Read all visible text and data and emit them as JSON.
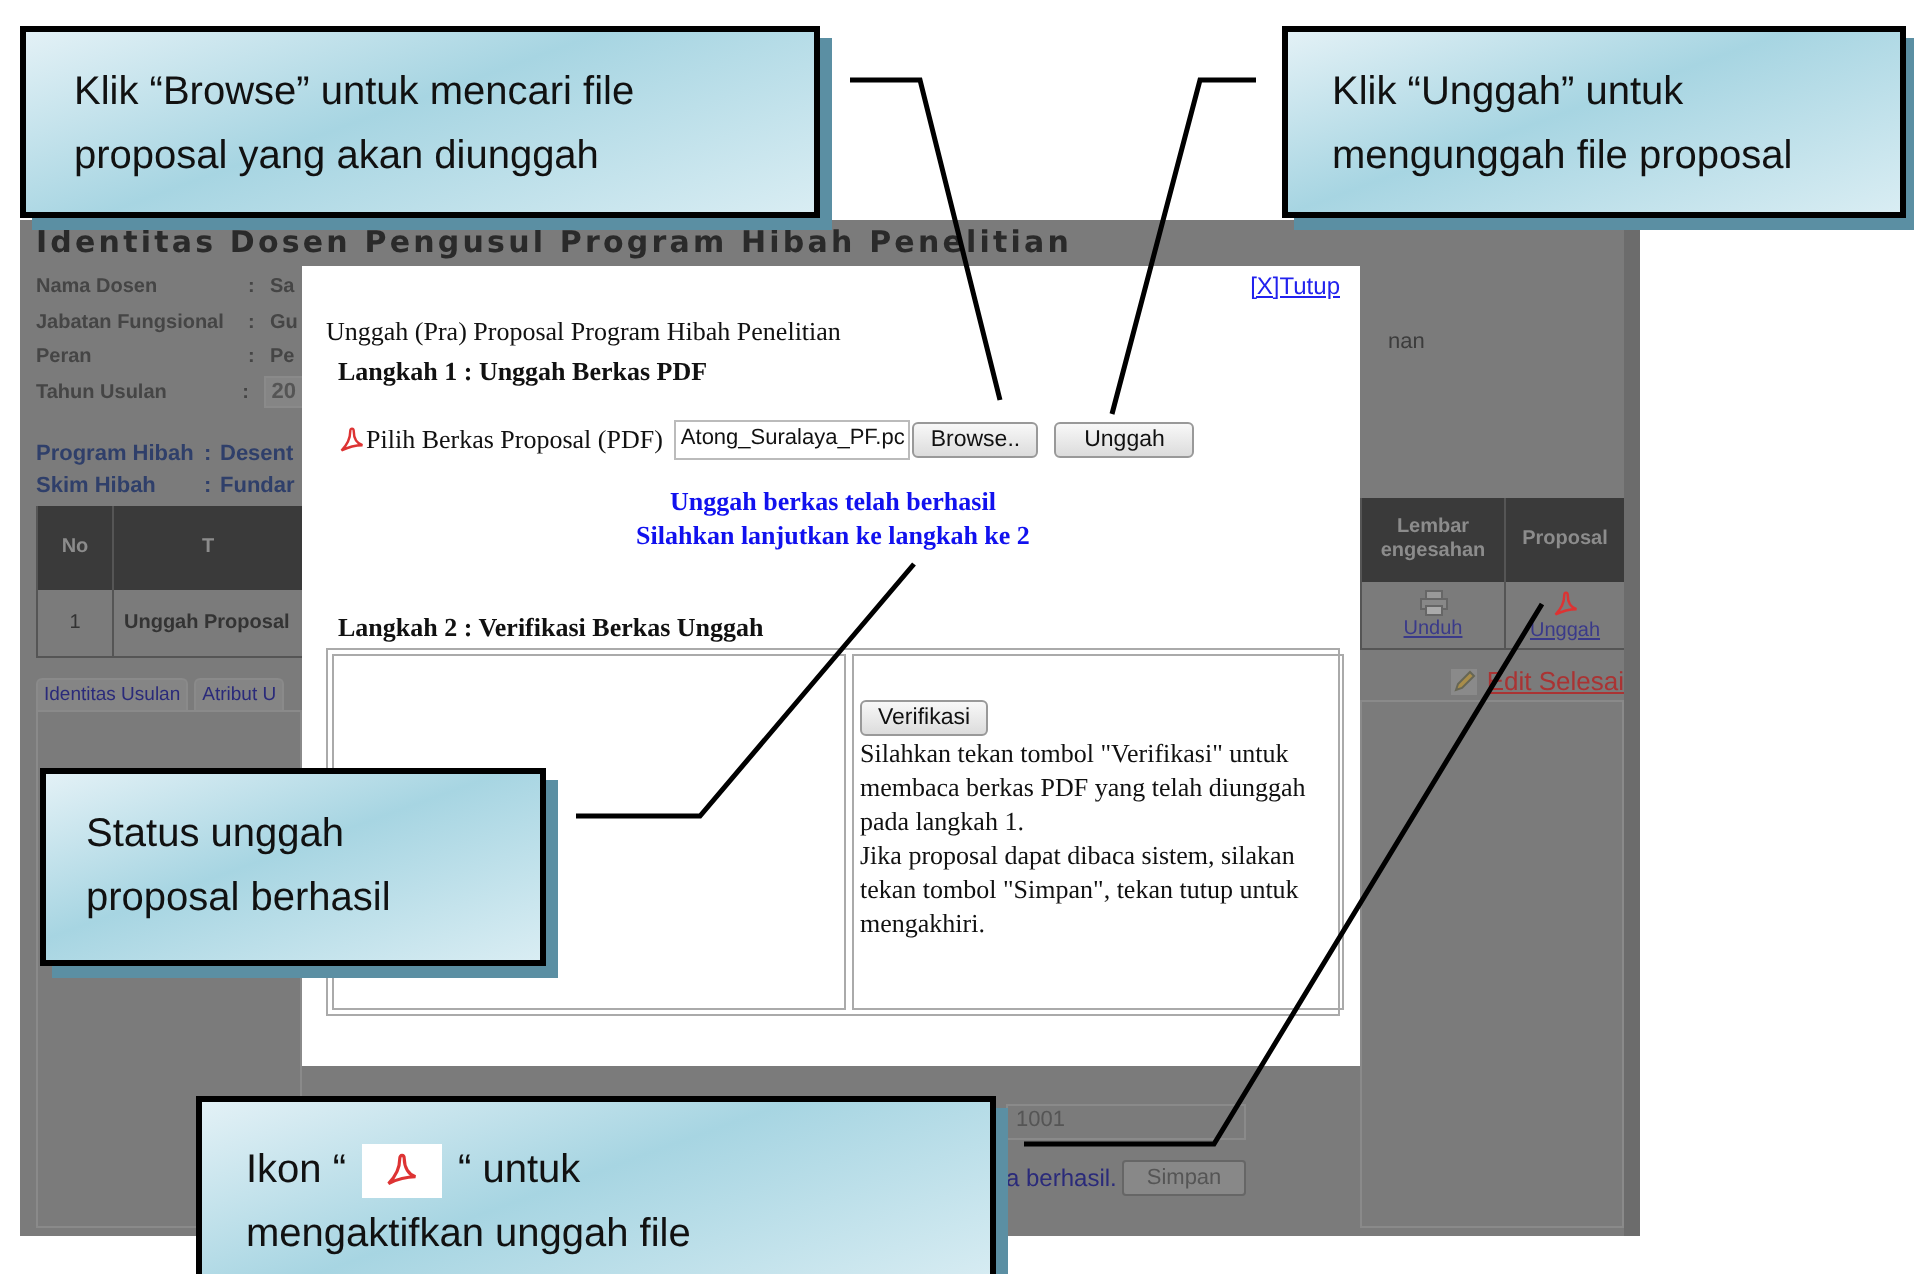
{
  "callouts": [
    {
      "kind": "text",
      "lines": [
        "Klik “Browse” untuk mencari file",
        "proposal yang akan diunggah"
      ]
    },
    {
      "kind": "text",
      "lines": [
        "Klik “Unggah” untuk",
        "mengunggah file proposal"
      ]
    },
    {
      "kind": "text",
      "lines": [
        "Status unggah",
        "proposal berhasil"
      ]
    },
    {
      "kind": "icon_text",
      "before_icon": "Ikon “",
      "after_icon": "“ untuk",
      "second_line": "mengaktifkan unggah file"
    }
  ],
  "app": {
    "title": "Identitas Dosen Pengusul Program Hibah Penelitian",
    "info": [
      {
        "label": "Nama Dosen",
        "separator": ":",
        "value": "Sa",
        "kind": "text"
      },
      {
        "label": "Jabatan Fungsional",
        "separator": ":",
        "value": "Gu",
        "kind": "text"
      },
      {
        "label": "Peran",
        "separator": ":",
        "value": "Pe",
        "kind": "text"
      },
      {
        "label": "Tahun Usulan",
        "separator": ":",
        "value": "20",
        "kind": "select"
      }
    ],
    "program": [
      {
        "label": "Program Hibah",
        "separator": ":",
        "value": "Desent"
      },
      {
        "label": "Skim Hibah",
        "separator": ":",
        "value": "Fundar"
      }
    ],
    "right_fragment": "nan",
    "table": {
      "columns": [
        "No",
        "T",
        "Lembar engesahan",
        "Proposal"
      ],
      "rows": [
        {
          "no": "1",
          "title": "Unggah Proposal",
          "lembar": "Unduh",
          "proposal": "Unggah"
        }
      ]
    },
    "tabs": [
      "Identitas Usulan",
      "Atribut U"
    ],
    "edit_link": "Edit Selesai",
    "code_field": "1001",
    "status_text": "a berhasil.",
    "save_button": "Simpan"
  },
  "dialog": {
    "close_link": "[X]Tutup",
    "heading": "Unggah (Pra) Proposal Program Hibah Penelitian",
    "step1_title": "Langkah 1 : Unggah Berkas PDF",
    "file_label": "Pilih Berkas Proposal (PDF)",
    "file_value": "Atong_Suralaya_PF.pc",
    "browse_button": "Browse..",
    "upload_button": "Unggah",
    "status_lines": [
      "Unggah berkas telah berhasil",
      "Silahkan lanjutkan ke langkah ke 2"
    ],
    "step2_title": "Langkah 2 : Verifikasi Berkas Unggah",
    "verify_button": "Verifikasi",
    "instructions": [
      "Silahkan tekan tombol \"Verifikasi\" untuk membaca berkas PDF yang telah diunggah pada langkah 1.",
      "Jika proposal dapat dibaca sistem, silakan tekan tombol \"Simpan\", tekan tutup untuk mengakhiri."
    ]
  }
}
